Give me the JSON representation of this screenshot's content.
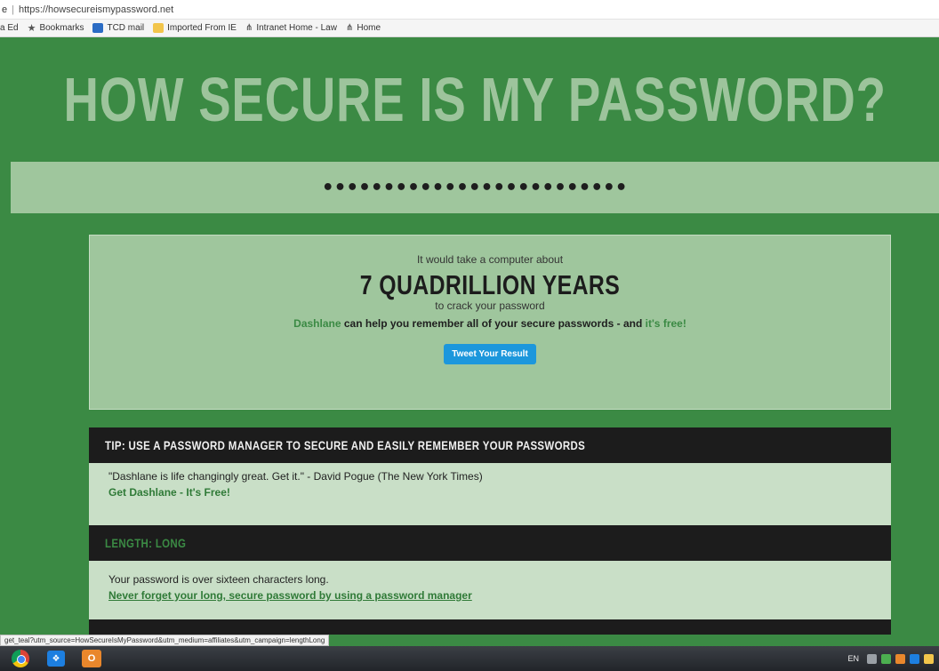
{
  "browser": {
    "tab_fragment": "e",
    "url": "https://howsecureismypassword.net",
    "bookmarks": [
      {
        "label": "a Ed"
      },
      {
        "label": "Bookmarks",
        "icon": "star-icon"
      },
      {
        "label": "TCD mail",
        "icon": "outlook-icon"
      },
      {
        "label": "Imported From IE",
        "icon": "folder-icon"
      },
      {
        "label": "Intranet Home - Law",
        "icon": "intranet-icon"
      },
      {
        "label": "Home",
        "icon": "intranet-icon"
      }
    ]
  },
  "header": {
    "title": "HOW SECURE IS MY PASSWORD?"
  },
  "password": {
    "masked": "•••••••••••••••••••••••••"
  },
  "result": {
    "pre_text": "It would take a computer about",
    "time": "7 QUADRILLION YEARS",
    "post_text": "to crack your password",
    "promo_brand": "Dashlane",
    "promo_middle": " can help you remember all of your secure passwords - and ",
    "promo_free": "it's free!",
    "tweet_label": "Tweet Your Result"
  },
  "tip": {
    "heading": "TIP: USE A PASSWORD MANAGER TO SECURE AND EASILY REMEMBER YOUR PASSWORDS",
    "quote": "\"Dashlane is life changingly great. Get it.\" - David Pogue (The New York Times)",
    "link": "Get Dashlane - It's Free!"
  },
  "length": {
    "heading": "LENGTH: LONG",
    "text": "Your password is over sixteen characters long.",
    "link": "Never forget your long, secure password by using a password manager"
  },
  "status_bar": {
    "text": "get_teal?utm_source=HowSecureIsMyPassword&utm_medium=affiliates&utm_campaign=lengthLong"
  },
  "taskbar": {
    "language": "EN"
  },
  "colors": {
    "page_green": "#3b8a44",
    "light_green": "#9fc69d",
    "pale_green": "#c9dfc7",
    "dark_bar": "#1c1c1c",
    "tweet_blue": "#1c97dc"
  }
}
